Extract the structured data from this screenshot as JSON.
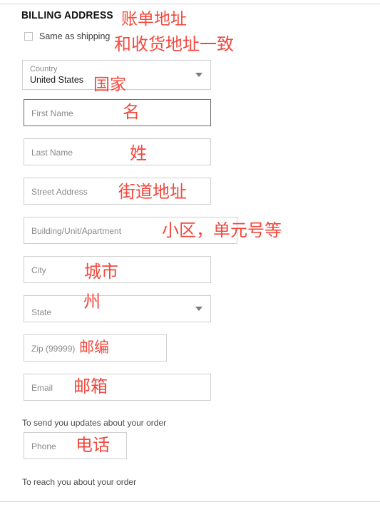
{
  "section": {
    "heading": "BILLING ADDRESS"
  },
  "same_as_shipping": {
    "label": "Same as shipping",
    "checked": false
  },
  "fields": {
    "country": {
      "label": "Country",
      "value": "United States",
      "type": "select"
    },
    "first_name": {
      "placeholder": "First Name",
      "value": "",
      "type": "text",
      "focused": true
    },
    "last_name": {
      "placeholder": "Last Name",
      "value": "",
      "type": "text"
    },
    "street_address": {
      "placeholder": "Street Address",
      "value": "",
      "type": "text"
    },
    "building_unit": {
      "placeholder": "Building/Unit/Apartment",
      "value": "",
      "type": "text"
    },
    "city": {
      "placeholder": "City",
      "value": "",
      "type": "text"
    },
    "state": {
      "placeholder": "State",
      "value": "",
      "type": "select"
    },
    "zip": {
      "placeholder": "Zip (99999)",
      "value": "",
      "type": "text"
    },
    "email": {
      "placeholder": "Email",
      "value": "",
      "type": "email"
    },
    "phone": {
      "placeholder": "Phone",
      "value": "",
      "type": "tel"
    }
  },
  "helpers": {
    "email_hint": "To send you updates about your order",
    "phone_hint": "To reach you about your order"
  },
  "annotations": {
    "color": "#f2483d",
    "billing_address": "账单地址",
    "same_as_shipping": "和收货地址一致",
    "country": "国家",
    "first_name": "名",
    "last_name": "姓",
    "street_address": "街道地址",
    "building_unit": "小区，单元号等",
    "city": "城市",
    "state": "州",
    "zip": "邮编",
    "email": "邮箱",
    "phone": "电话"
  }
}
